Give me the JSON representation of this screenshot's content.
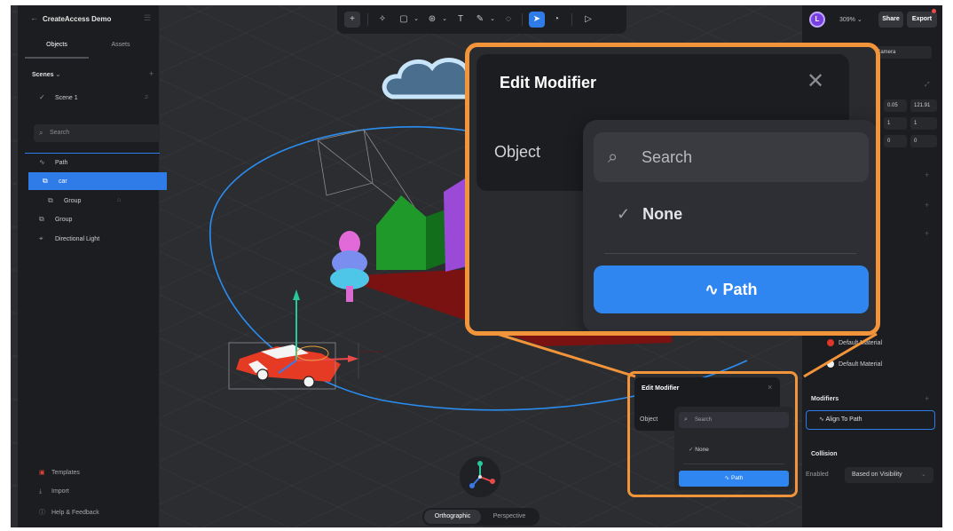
{
  "project": {
    "title": "CreateAccess Demo"
  },
  "left_panel": {
    "tabs": [
      "Objects",
      "Assets"
    ],
    "scenes_label": "Scenes",
    "scene_item": "Scene 1",
    "search_placeholder": "Search",
    "layers": [
      {
        "label": "Path",
        "icon": "path-icon"
      },
      {
        "label": "car",
        "icon": "group-icon",
        "selected": true
      },
      {
        "label": "Group",
        "icon": "group-icon"
      },
      {
        "label": "Group",
        "icon": "group-icon"
      },
      {
        "label": "Directional Light",
        "icon": "light-icon"
      }
    ],
    "bottom": {
      "templates": "Templates",
      "import": "Import",
      "help": "Help & Feedback"
    }
  },
  "toolbar": {
    "icons": [
      "plus-icon",
      "sparkle-icon",
      "square-icon",
      "sphere-icon",
      "text-icon",
      "pen-icon",
      "comment-icon",
      "cursor-icon",
      "hand-icon",
      "play-icon"
    ]
  },
  "right_panel": {
    "avatar": "L",
    "zoom": "309%",
    "share": "Share",
    "export": "Export",
    "camera_value": "Camera",
    "values": [
      "0.05",
      "121.91",
      "1",
      "1",
      "0",
      "0"
    ],
    "materials": [
      {
        "label": "Default Material",
        "color": "#e0352b"
      },
      {
        "label": "Default Material",
        "color": "#f0f0f0"
      }
    ],
    "modifiers_label": "Modifiers",
    "modifier_item": "Align To Path",
    "collision_label": "Collision",
    "enabled_label": "Enabled",
    "visibility_value": "Based on Visibility"
  },
  "view": {
    "orthographic": "Orthographic",
    "perspective": "Perspective"
  },
  "edit_modifier": {
    "title": "Edit Modifier",
    "object_label": "Object",
    "search_placeholder": "Search",
    "option_none": "None",
    "option_path": "Path"
  },
  "colors": {
    "accent": "#2f86f0",
    "callout": "#f2953a"
  }
}
